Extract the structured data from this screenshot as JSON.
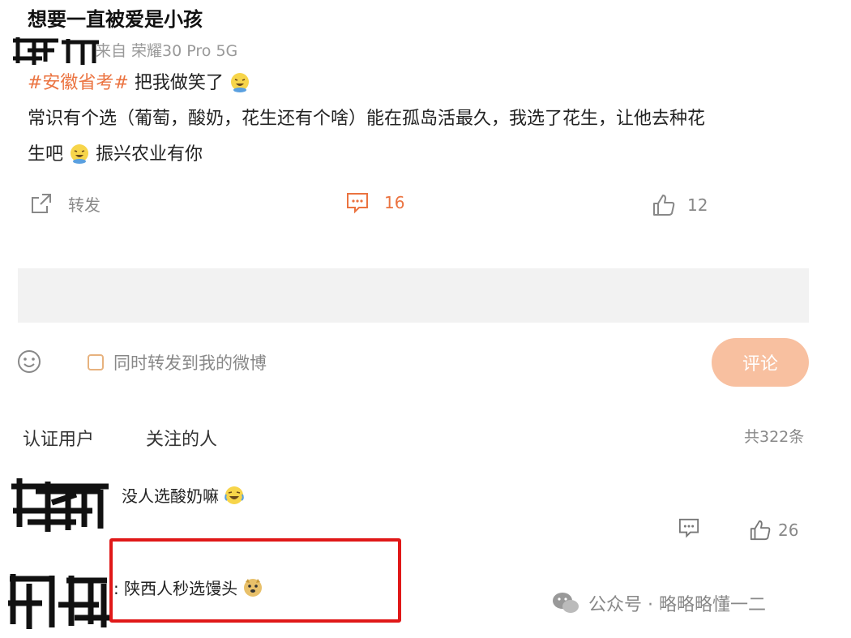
{
  "post": {
    "author_title": "想要一直被爱是小孩",
    "source": "来自 荣耀30 Pro 5G",
    "topic": "#安徽省考#",
    "line1_rest": " 把我做笑了",
    "line2": "常识有个选（葡萄，酸奶，花生还有个啥）能在孤岛活最久，我选了花生，让他去种花",
    "line3_a": "生吧",
    "line3_b": "振兴农业有你"
  },
  "actions": {
    "forward_label": "转发",
    "comment_count": "16",
    "like_count": "12"
  },
  "composer": {
    "repost_label": "同时转发到我的微博",
    "submit_label": "评论"
  },
  "comments_header": {
    "tab_verified": "认证用户",
    "tab_following": "关注的人",
    "total": "共322条"
  },
  "comments": [
    {
      "text": "没人选酸奶嘛",
      "like_count": "26"
    },
    {
      "text": ": 陕西人秒选馒头"
    }
  ],
  "watermark": {
    "text": "公众号 · 略略略懂一二"
  },
  "colors": {
    "accent": "#eb7340",
    "highlight": "#e01818",
    "submit_bg": "#f8c0a0"
  }
}
